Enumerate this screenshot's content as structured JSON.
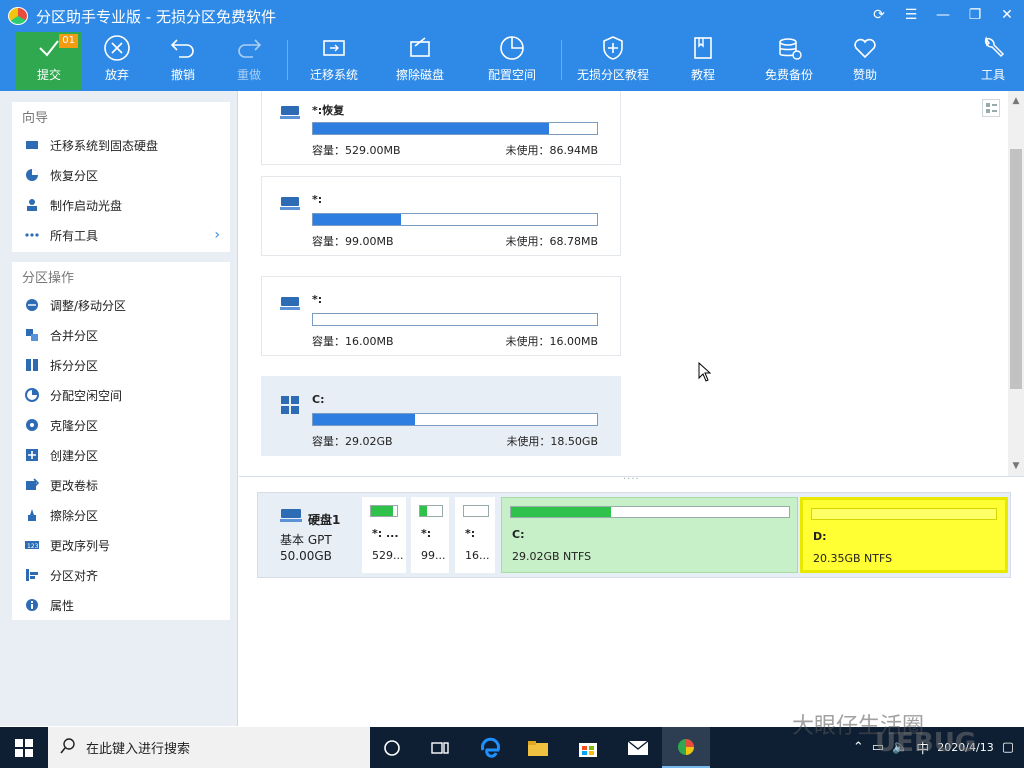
{
  "window": {
    "title": "分区助手专业版 - 无损分区免费软件"
  },
  "toolbar": {
    "commit_label": "提交",
    "commit_badge": "01",
    "discard_label": "放弃",
    "undo_label": "撤销",
    "redo_label": "重做",
    "migrate_label": "迁移系统",
    "wipe_label": "擦除磁盘",
    "allocate_label": "配置空间",
    "tutorial_nondestructive_label": "无损分区教程",
    "tutorial_label": "教程",
    "backup_label": "免费备份",
    "sponsor_label": "赞助",
    "tools_label": "工具"
  },
  "sidebar": {
    "wizard_title": "向导",
    "wizard_items": [
      {
        "label": "迁移系统到固态硬盘",
        "icon": "migrate-icon"
      },
      {
        "label": "恢复分区",
        "icon": "pie-icon"
      },
      {
        "label": "制作启动光盘",
        "icon": "user-disk-icon"
      },
      {
        "label": "所有工具",
        "icon": "dots-icon"
      }
    ],
    "ops_title": "分区操作",
    "ops_items": [
      {
        "label": "调整/移动分区",
        "icon": "resize-icon"
      },
      {
        "label": "合并分区",
        "icon": "merge-icon"
      },
      {
        "label": "拆分分区",
        "icon": "split-icon"
      },
      {
        "label": "分配空闲空间",
        "icon": "allocate-icon"
      },
      {
        "label": "克隆分区",
        "icon": "clone-icon"
      },
      {
        "label": "创建分区",
        "icon": "create-icon"
      },
      {
        "label": "更改卷标",
        "icon": "label-icon"
      },
      {
        "label": "擦除分区",
        "icon": "wipe-icon"
      },
      {
        "label": "更改序列号",
        "icon": "serial-icon"
      },
      {
        "label": "分区对齐",
        "icon": "align-icon"
      },
      {
        "label": "属性",
        "icon": "info-icon"
      }
    ]
  },
  "partitions": [
    {
      "name": "*:恢复",
      "capacity": "容量：529.00MB",
      "free": "未使用：86.94MB",
      "used_fraction": 0.83
    },
    {
      "name": "*:",
      "capacity": "容量：99.00MB",
      "free": "未使用：68.78MB",
      "used_fraction": 0.31
    },
    {
      "name": "*:",
      "capacity": "容量：16.00MB",
      "free": "未使用：16.00MB",
      "used_fraction": 0.0
    },
    {
      "name": "C:",
      "capacity": "容量：29.02GB",
      "free": "未使用：18.50GB",
      "used_fraction": 0.36
    }
  ],
  "disk": {
    "name": "硬盘1",
    "type": "基本 GPT",
    "size": "50.00GB",
    "parts": [
      {
        "name": "*: ...",
        "info": "529...",
        "used_fraction": 0.83
      },
      {
        "name": "*:",
        "info": "99...",
        "used_fraction": 0.31
      },
      {
        "name": "*:",
        "info": "16...",
        "used_fraction": 0.0
      },
      {
        "name": "C:",
        "info": "29.02GB NTFS",
        "used_fraction": 0.36
      },
      {
        "name": "D:",
        "info": "20.35GB NTFS",
        "used_fraction": 0.0
      }
    ]
  },
  "taskbar": {
    "search_placeholder": "在此键入进行搜索",
    "ime": "中",
    "date": "2020/4/13"
  },
  "watermark": {
    "text": "大眼仔生活圈",
    "logo": "UEBUG"
  },
  "colors": {
    "toolbar_blue": "#2e8ae6",
    "commit_green": "#2fa84f",
    "bar_blue": "#2e7de0",
    "bar_green": "#2fc24a",
    "selected_partition": "#ffff33"
  }
}
